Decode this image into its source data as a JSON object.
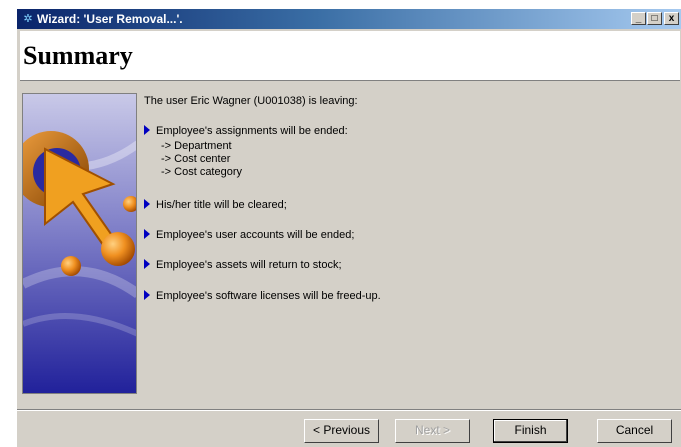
{
  "window": {
    "title": "Wizard: 'User Removal...'.",
    "controls": {
      "minimize": "_",
      "maximize": "□",
      "close": "x"
    }
  },
  "header": {
    "title": "Summary"
  },
  "summary": {
    "intro": "The user Eric Wagner (U001038) is leaving:",
    "items": [
      {
        "text": "Employee's assignments will be ended:",
        "subitems": [
          "-> Department",
          "-> Cost center",
          "-> Cost category"
        ]
      },
      {
        "text": "His/her title will be cleared;"
      },
      {
        "text": "Employee's user accounts will be ended;"
      },
      {
        "text": "Employee's assets will return to stock;"
      },
      {
        "text": "Employee's software licenses will be freed-up."
      }
    ]
  },
  "buttons": {
    "previous": "< Previous",
    "next": "Next >",
    "finish": "Finish",
    "cancel": "Cancel"
  },
  "colors": {
    "title_bar": "#0a246a",
    "bullet": "#0000c0",
    "dialog_bg": "#d4d0c8"
  }
}
